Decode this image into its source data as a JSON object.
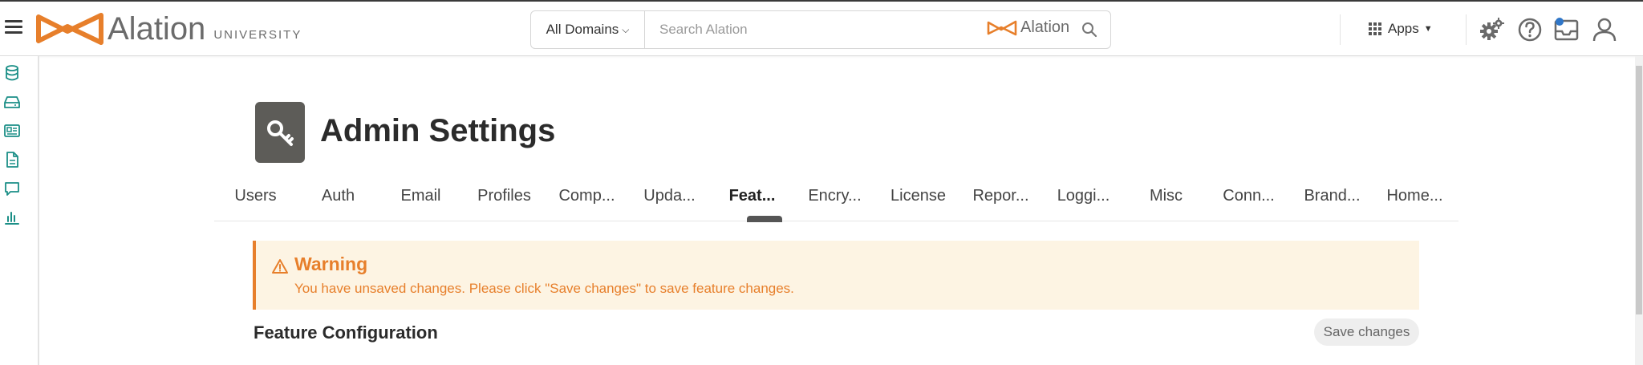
{
  "brand": {
    "name": "Alation",
    "sub": "UNIVERSITY"
  },
  "search": {
    "domains_label": "All Domains",
    "placeholder": "Search Alation",
    "brand_label": "Alation"
  },
  "topnav": {
    "apps_label": "Apps"
  },
  "page": {
    "title": "Admin Settings"
  },
  "tabs": [
    {
      "label": "Users",
      "active": false
    },
    {
      "label": "Auth",
      "active": false
    },
    {
      "label": "Email",
      "active": false
    },
    {
      "label": "Profiles",
      "active": false
    },
    {
      "label": "Comp...",
      "active": false
    },
    {
      "label": "Upda...",
      "active": false
    },
    {
      "label": "Feat...",
      "active": true
    },
    {
      "label": "Encry...",
      "active": false
    },
    {
      "label": "License",
      "active": false
    },
    {
      "label": "Repor...",
      "active": false
    },
    {
      "label": "Loggi...",
      "active": false
    },
    {
      "label": "Misc",
      "active": false
    },
    {
      "label": "Conn...",
      "active": false
    },
    {
      "label": "Brand...",
      "active": false
    },
    {
      "label": "Home...",
      "active": false
    }
  ],
  "warning": {
    "title": "Warning",
    "message": "You have unsaved changes. Please click \"Save changes\" to save feature changes."
  },
  "section": {
    "title": "Feature Configuration",
    "save_label": "Save changes"
  },
  "rail": [
    "database-icon",
    "drive-icon",
    "card-icon",
    "document-icon",
    "chat-icon",
    "chart-icon"
  ],
  "colors": {
    "accent": "#e77f2b",
    "teal": "#1b8f87",
    "warning_bg": "#fdf4e3",
    "tile": "#5d5c58"
  }
}
